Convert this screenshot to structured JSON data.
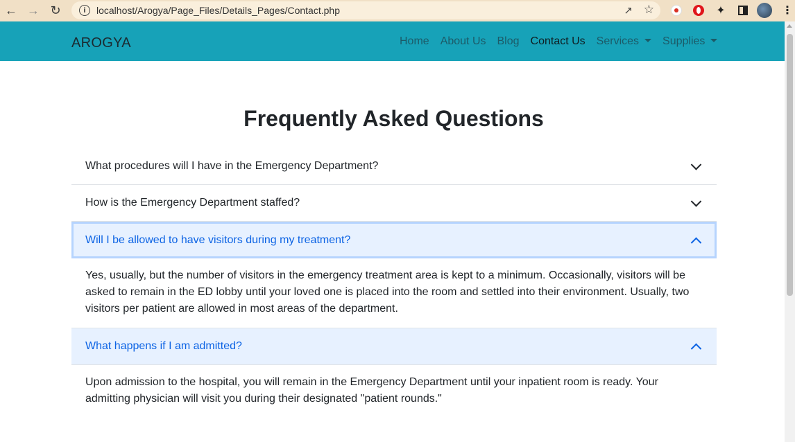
{
  "browser": {
    "url": "localhost/Arogya/Page_Files/Details_Pages/Contact.php"
  },
  "navbar": {
    "brand": "AROGYA",
    "links": [
      "Home",
      "About Us",
      "Blog",
      "Contact Us",
      "Services",
      "Supplies"
    ]
  },
  "faq": {
    "title": "Frequently Asked Questions",
    "items": [
      {
        "question": "What procedures will I have in the Emergency Department?",
        "expanded": false,
        "answer": ""
      },
      {
        "question": "How is the Emergency Department staffed?",
        "expanded": false,
        "answer": ""
      },
      {
        "question": "Will I be allowed to have visitors during my treatment?",
        "expanded": true,
        "answer": "Yes, usually, but the number of visitors in the emergency treatment area is kept to a minimum. Occasionally, visitors will be asked to remain in the ED lobby until your loved one is placed into the room and settled into their environment. Usually, two visitors per patient are allowed in most areas of the department."
      },
      {
        "question": "What happens if I am admitted?",
        "expanded": true,
        "answer": "Upon admission to the hospital, you will remain in the Emergency Department until your inpatient room is ready. Your admitting physician will visit you during their designated \"patient rounds.\""
      }
    ]
  },
  "colors": {
    "navbar_bg": "#17a2b8",
    "accordion_active_bg": "#e7f1ff",
    "accordion_active_text": "#0c63e4"
  }
}
